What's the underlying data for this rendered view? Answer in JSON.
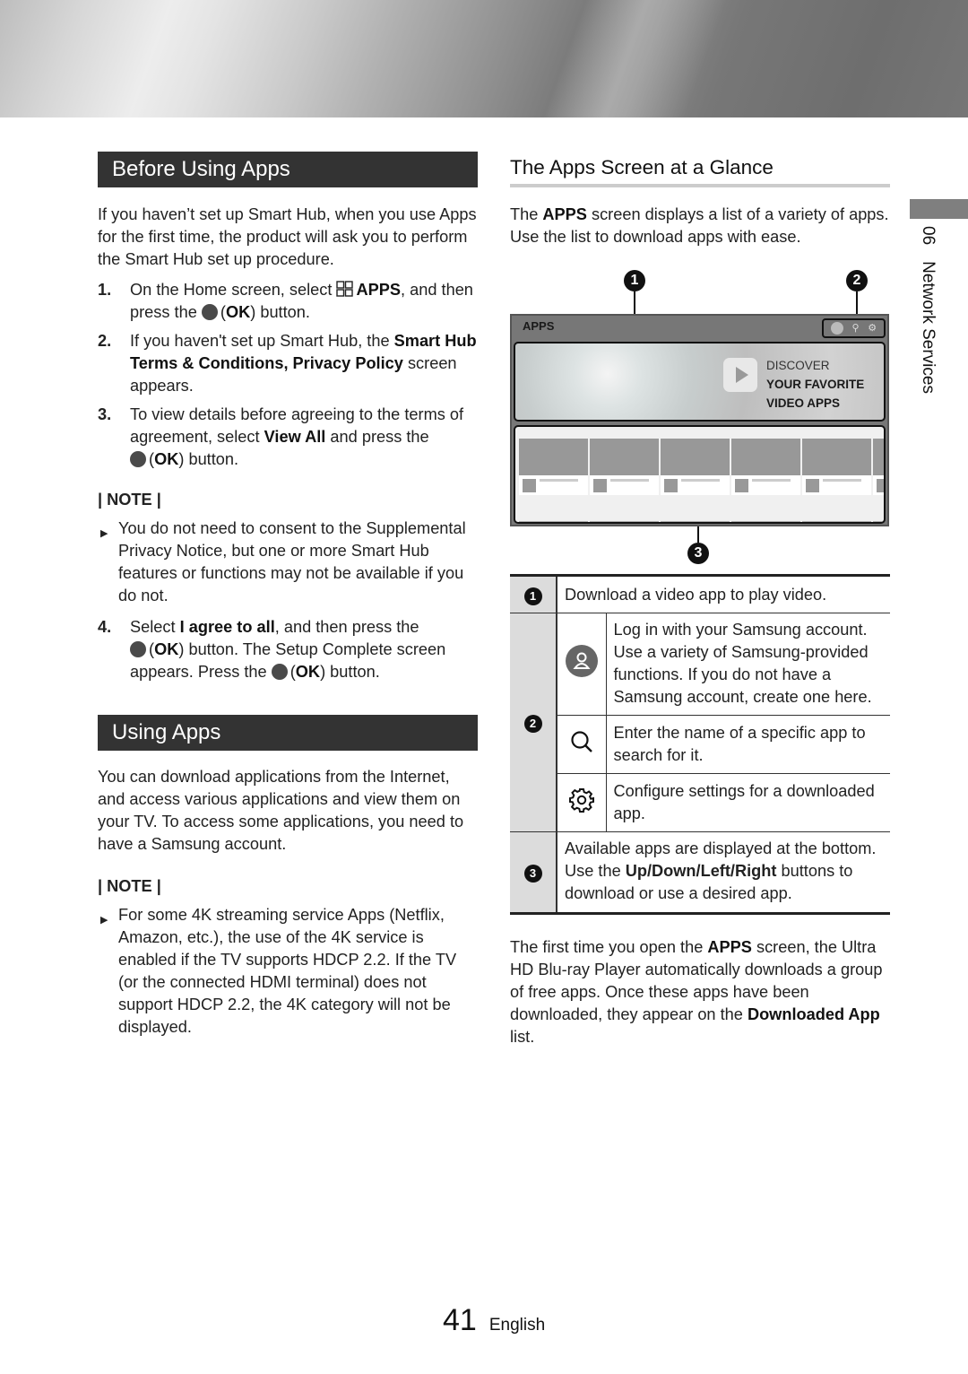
{
  "left": {
    "before_using_apps": {
      "title": "Before Using Apps",
      "intro": "If you haven’t set up Smart Hub, when you use Apps for the first time, the product will ask you to perform the Smart Hub set up procedure.",
      "steps": [
        {
          "num": "1.",
          "parts": [
            "On the Home screen, select ",
            "APPS",
            ", and then press the ",
            "OK",
            ") button."
          ]
        },
        {
          "num": "2.",
          "parts": [
            "If you haven't set up Smart Hub, the ",
            "Smart Hub Terms & Conditions, Privacy Policy",
            " screen appears."
          ]
        },
        {
          "num": "3.",
          "parts": [
            "To view details before agreeing to the terms of agreement, select ",
            "View All",
            " and press the ",
            "OK",
            ") button."
          ]
        }
      ],
      "note_label": "| NOTE |",
      "note_items": [
        "You do not need to consent to the Supplemental Privacy Notice, but one or more Smart Hub features or functions may not be available if you do not."
      ],
      "step4": {
        "num": "4.",
        "parts": [
          "Select ",
          "I agree to all",
          ", and then press the ",
          "OK",
          ") button. The Setup Complete screen appears. Press the ",
          "OK",
          ") button."
        ]
      }
    },
    "using_apps": {
      "title": "Using Apps",
      "intro": "You can download applications from the Internet, and access various applications and view them on your TV. To access some applications, you need to have a Samsung account.",
      "note_label": "| NOTE |",
      "note_items": [
        "For some 4K streaming service Apps (Netflix, Amazon, etc.), the use of the 4K service is enabled if the TV supports HDCP 2.2. If the TV (or the connected HDMI terminal) does not support HDCP 2.2, the 4K category will not be displayed."
      ]
    }
  },
  "right": {
    "title": "The Apps Screen at a Glance",
    "intro_parts": [
      "The ",
      "APPS",
      " screen displays a list of a variety of apps. Use the list to download apps with ease."
    ],
    "illustration": {
      "callouts": [
        "1",
        "2",
        "3"
      ],
      "screen_title": "APPS",
      "icons": [
        "user-icon",
        "search-icon",
        "gear-icon"
      ],
      "banner_lines": [
        "DISCOVER",
        "YOUR FAVORITE",
        "VIDEO APPS"
      ]
    },
    "legend": [
      {
        "num": "1",
        "text": "Download a video app to play video."
      },
      {
        "num": "2",
        "sub": [
          {
            "icon": "user-icon",
            "text": "Log in with your Samsung account. Use a variety of Samsung-provided functions. If you do not have a Samsung account, create one here."
          },
          {
            "icon": "search-icon",
            "text": "Enter the name of a specific app to search for it."
          },
          {
            "icon": "gear-icon",
            "text": "Configure settings for a downloaded app."
          }
        ]
      },
      {
        "num": "3",
        "parts": [
          "Available apps are displayed at the bottom. Use the ",
          "Up/Down/Left/Right",
          " buttons to download or use a desired app."
        ]
      }
    ],
    "outro_parts": [
      "The first time you open the ",
      "APPS",
      " screen, the Ultra HD Blu-ray Player automatically downloads a group of free apps. Once these apps have been downloaded, they appear on the ",
      "Downloaded App",
      " list."
    ]
  },
  "side_tab": {
    "chapter": "06",
    "label": "Network Services"
  },
  "footer": {
    "page": "41",
    "language": "English"
  }
}
